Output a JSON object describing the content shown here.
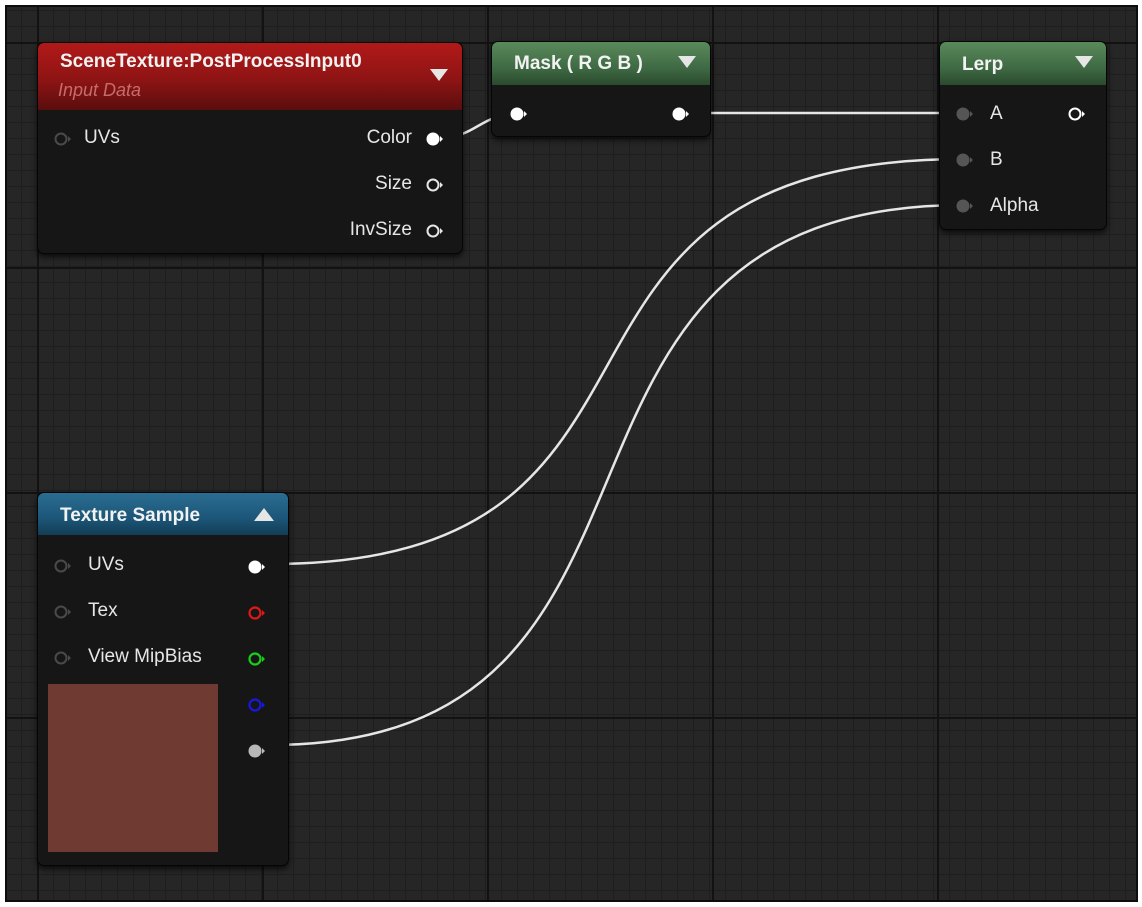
{
  "graph": {
    "background_color": "#262626",
    "wire_color": "#e6e6e6"
  },
  "nodes": {
    "scene_texture": {
      "title": "SceneTexture:PostProcessInput0",
      "subtitle": "Input Data",
      "header_color": "#9b1616",
      "inputs": [
        {
          "label": "UVs"
        }
      ],
      "outputs": [
        {
          "label": "Color"
        },
        {
          "label": "Size"
        },
        {
          "label": "InvSize"
        }
      ]
    },
    "mask": {
      "title": "Mask ( R G B )",
      "header_color": "#4a7a4e"
    },
    "lerp": {
      "title": "Lerp",
      "header_color": "#4a7a4e",
      "inputs": [
        {
          "label": "A"
        },
        {
          "label": "B"
        },
        {
          "label": "Alpha"
        }
      ]
    },
    "texture_sample": {
      "title": "Texture Sample",
      "header_color": "#1f5f84",
      "inputs": [
        {
          "label": "UVs"
        },
        {
          "label": "Tex"
        },
        {
          "label": "View MipBias"
        }
      ],
      "outputs": [
        {
          "channel": "rgb",
          "color": "#ffffff"
        },
        {
          "channel": "r",
          "color": "#e01818"
        },
        {
          "channel": "g",
          "color": "#18d018"
        },
        {
          "channel": "b",
          "color": "#1818e0"
        },
        {
          "channel": "a",
          "color": "#b8b8b8"
        }
      ],
      "preview_color": "#6e3a32"
    }
  },
  "pin_colors": {
    "connected_white": "#ffffff",
    "unconnected_input": "#5a5a5a",
    "red": "#e01818",
    "green": "#18d018",
    "blue": "#1818e0",
    "alpha": "#b8b8b8"
  }
}
